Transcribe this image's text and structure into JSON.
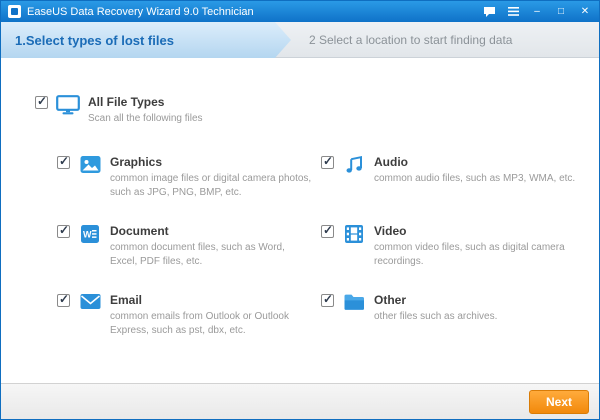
{
  "window": {
    "title": "EaseUS Data Recovery Wizard 9.0 Technician",
    "controls": {
      "minimize": "–",
      "maximize": "□",
      "close": "✕"
    }
  },
  "steps": [
    {
      "label": "1.Select types of lost files",
      "active": true
    },
    {
      "label": "2 Select a location to start finding data",
      "active": false
    }
  ],
  "all_file_types": {
    "title": "All File Types",
    "desc": "Scan all the following files",
    "checked": true,
    "icon": "monitor-icon"
  },
  "categories": [
    {
      "title": "Graphics",
      "desc": "common image files or digital camera photos, such as JPG, PNG, BMP, etc.",
      "checked": true,
      "icon": "graphics-icon"
    },
    {
      "title": "Document",
      "desc": "common document files, such as Word, Excel, PDF files, etc.",
      "checked": true,
      "icon": "document-icon"
    },
    {
      "title": "Email",
      "desc": "common emails from Outlook or Outlook Express, such as pst, dbx, etc.",
      "checked": true,
      "icon": "email-icon"
    },
    {
      "title": "Audio",
      "desc": "common audio files, such as MP3, WMA, etc.",
      "checked": true,
      "icon": "audio-icon"
    },
    {
      "title": "Video",
      "desc": "common video files, such as digital camera recordings.",
      "checked": true,
      "icon": "video-icon"
    },
    {
      "title": "Other",
      "desc": "other files such as archives.",
      "checked": true,
      "icon": "other-icon"
    }
  ],
  "footer": {
    "next_label": "Next"
  },
  "colors": {
    "titlebar": "#1584d8",
    "accent_blue": "#2b90d9",
    "step_text": "#1b6cb7",
    "next_button": "#f2890b"
  }
}
